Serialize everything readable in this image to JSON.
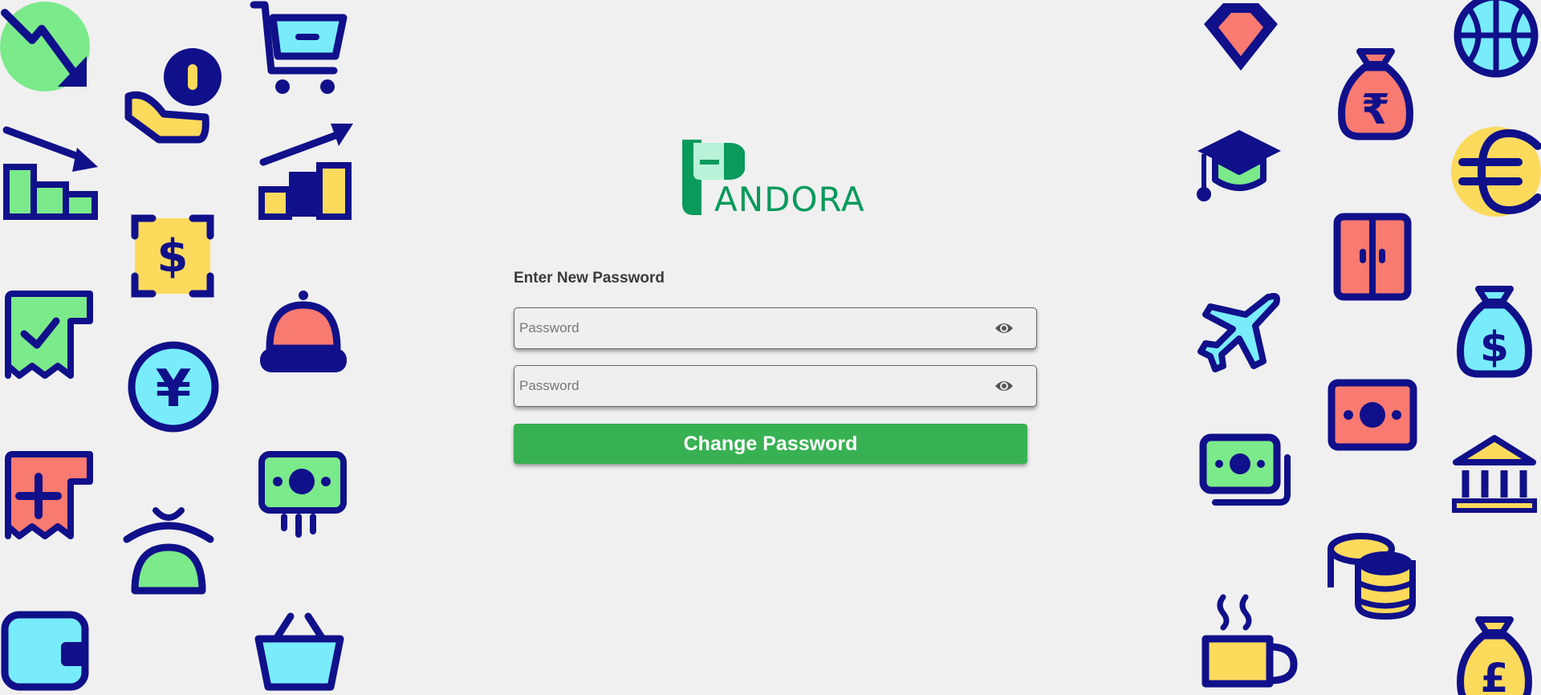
{
  "brand": {
    "logo_text": "ANDORA",
    "color": "#0a9a5c"
  },
  "form": {
    "label": "Enter New Password",
    "password_placeholder": "Password",
    "confirm_placeholder": "Password",
    "submit_label": "Change Password"
  },
  "colors": {
    "navy": "#10108a",
    "green": "#7bea8a",
    "red": "#f97a70",
    "cyan": "#78ecfb",
    "yellow": "#fcda5c",
    "button": "#38b153",
    "background": "#f0f0f0"
  },
  "decorations": [
    "trend-down-icon",
    "coin-hand-icon",
    "shopping-cart-icon",
    "bar-chart-down-icon",
    "bar-chart-up-icon",
    "dollar-bill-icon",
    "receipt-check-icon",
    "service-bell-icon",
    "yen-coin-icon",
    "receipt-plus-icon",
    "cash-icon",
    "purse-icon",
    "wallet-icon",
    "basket-icon",
    "diamond-icon",
    "rupee-bag-icon",
    "basketball-icon",
    "graduation-cap-icon",
    "euro-coin-icon",
    "safe-icon",
    "airplane-icon",
    "dollar-bag-icon",
    "cash-note-icon",
    "cash-stack-icon",
    "bank-icon",
    "coin-stack-icon",
    "coffee-mug-icon",
    "pound-bag-icon"
  ]
}
